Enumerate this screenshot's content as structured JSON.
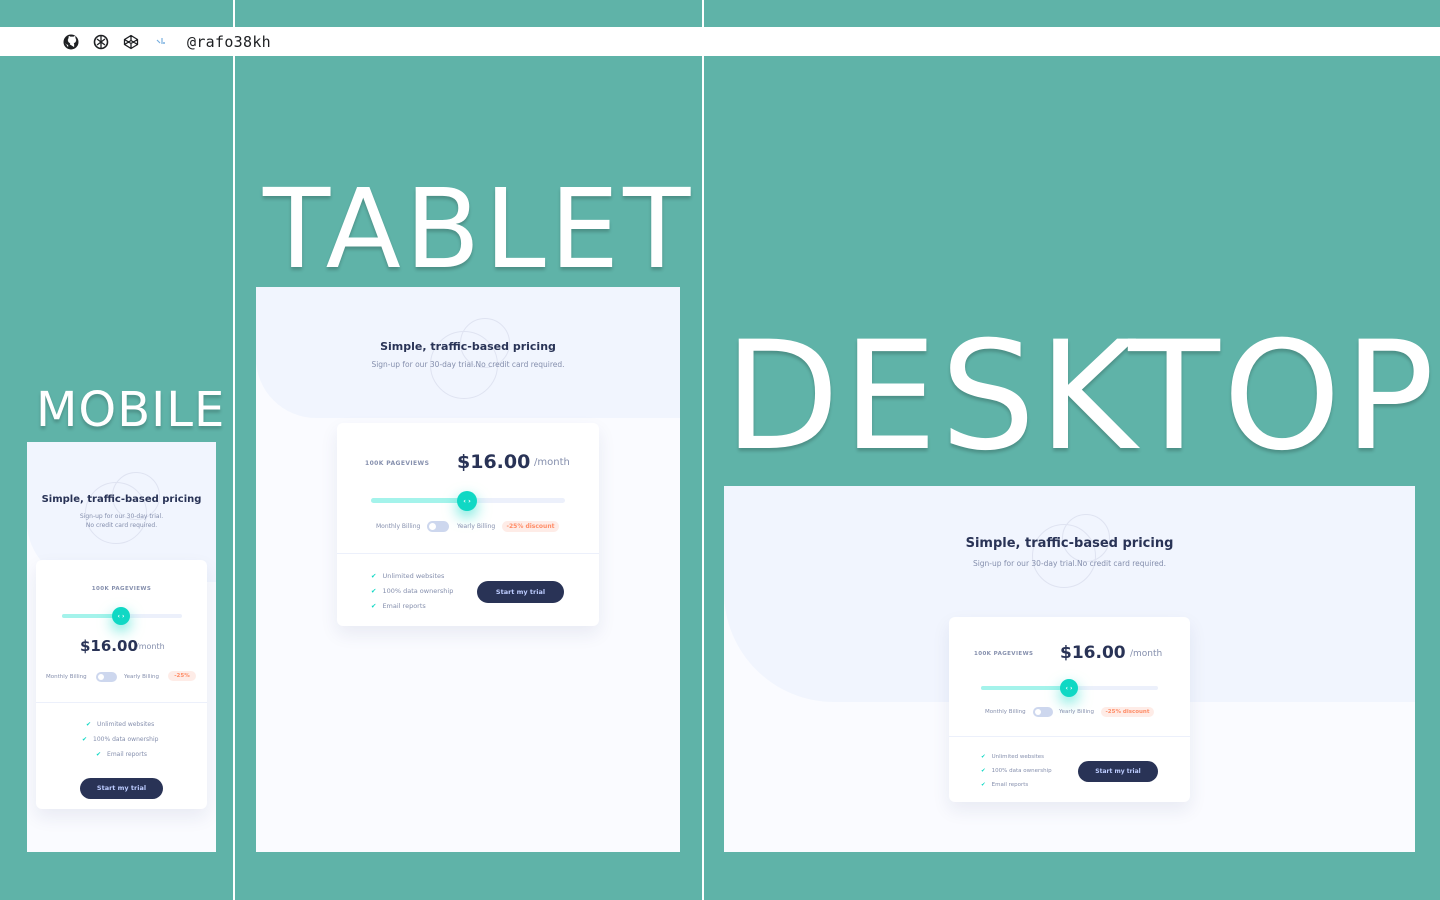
{
  "topbar": {
    "handle": "@rafo38kh",
    "icons": [
      "github-icon",
      "codesandbox-icon",
      "codepen-icon",
      "vscode-icon"
    ]
  },
  "labels": {
    "mobile": "MOBILE",
    "tablet": "TABLET",
    "desktop": "DESKTOP"
  },
  "pricing": {
    "title": "Simple, traffic-based pricing",
    "subtitle": "Sign-up for our 30-day trial.No credit card required.",
    "subtitle_line1": "Sign-up for our 30-day trial.",
    "subtitle_line2": "No credit card required.",
    "pageviews": "100K PAGEVIEWS",
    "price": "$16.00",
    "period": "/month",
    "monthly": "Monthly Billing",
    "yearly": "Yearly Billing",
    "discount": "-25% discount",
    "discount_short": "-25%",
    "features": [
      "Unlimited websites",
      "100% data ownership",
      "Email reports"
    ],
    "cta": "Start my trial",
    "slider_fraction": 0.5,
    "thumb_glyph": "‹ ›",
    "check_glyph": "✔"
  },
  "colors": {
    "background": "#5fb3a8",
    "accent": "#10d8c4",
    "dark_blue": "#293356",
    "discount": "#ff8c66"
  }
}
